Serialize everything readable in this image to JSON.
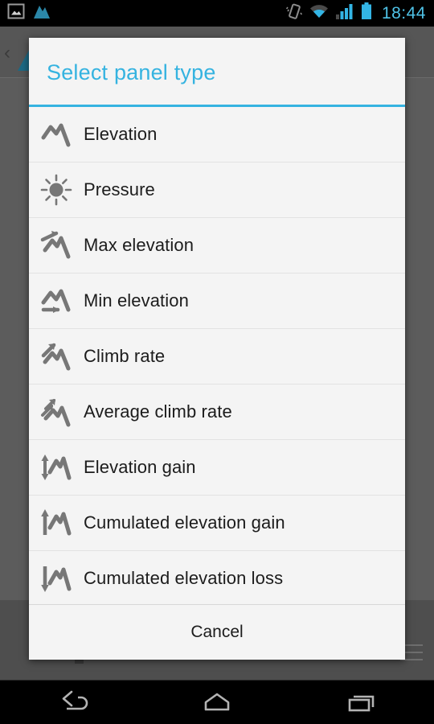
{
  "status_bar": {
    "clock": "18:44",
    "left_icons": [
      {
        "name": "gallery-image-icon",
        "label": "Image"
      },
      {
        "name": "mountain-app-icon",
        "label": "Altimeter"
      }
    ],
    "right_icons": [
      {
        "name": "vibrate-icon",
        "label": "Vibrate"
      },
      {
        "name": "wifi-icon",
        "label": "Wi-Fi"
      },
      {
        "name": "signal-bars-icon",
        "label": "Signal"
      },
      {
        "name": "battery-icon",
        "label": "Battery"
      }
    ]
  },
  "background_app": {
    "back_chevron": "‹"
  },
  "dialog": {
    "title": "Select panel type",
    "accent_color": "#35b3e0",
    "background_color": "#f4f4f4",
    "items": [
      {
        "label": "Elevation",
        "icon": "mountain-icon"
      },
      {
        "label": "Pressure",
        "icon": "sun-icon"
      },
      {
        "label": "Max elevation",
        "icon": "mountain-arrow-top-icon"
      },
      {
        "label": "Min elevation",
        "icon": "mountain-arrow-bottom-icon"
      },
      {
        "label": "Climb rate",
        "icon": "mountain-arrow-up-diagonal-icon"
      },
      {
        "label": "Average climb rate",
        "icon": "mountain-double-arrow-up-diagonal-icon"
      },
      {
        "label": "Elevation gain",
        "icon": "mountain-updown-arrow-icon"
      },
      {
        "label": "Cumulated elevation gain",
        "icon": "mountain-up-arrow-icon"
      },
      {
        "label": "Cumulated elevation loss",
        "icon": "mountain-down-arrow-icon"
      }
    ],
    "cancel_label": "Cancel"
  },
  "nav_bar": {
    "buttons": [
      {
        "name": "back-button",
        "label": "Back"
      },
      {
        "name": "home-button",
        "label": "Home"
      },
      {
        "name": "recents-button",
        "label": "Recent apps"
      }
    ]
  }
}
